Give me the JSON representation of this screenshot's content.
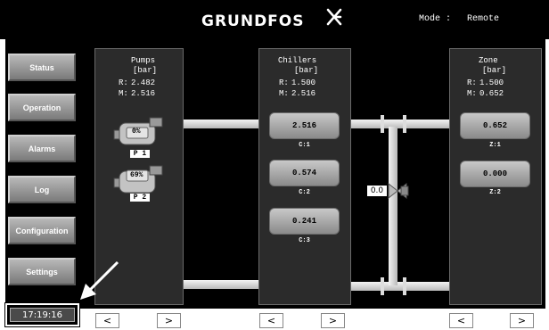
{
  "header": {
    "logo": "GRUNDFOS",
    "mode_label": "Mode :",
    "mode_value": "Remote"
  },
  "sidebar": {
    "items": [
      {
        "label": "Status"
      },
      {
        "label": "Operation"
      },
      {
        "label": "Alarms"
      },
      {
        "label": "Log"
      },
      {
        "label": "Configuration"
      },
      {
        "label": "Settings"
      }
    ]
  },
  "clock": "17:19:16",
  "pumps_panel": {
    "title": "Pumps",
    "unit": "[bar]",
    "r_label": "R:",
    "r_value": "2.482",
    "m_label": "M:",
    "m_value": "2.516",
    "pumps": [
      {
        "speed": "0%",
        "label": "P 1"
      },
      {
        "speed": "69%",
        "label": "P 2"
      }
    ]
  },
  "chillers_panel": {
    "title": "Chillers",
    "unit": "[bar]",
    "r_label": "R:",
    "r_value": "1.500",
    "m_label": "M:",
    "m_value": "2.516",
    "chillers": [
      {
        "value": "2.516",
        "label": "C:1"
      },
      {
        "value": "0.574",
        "label": "C:2"
      },
      {
        "value": "0.241",
        "label": "C:3"
      }
    ]
  },
  "zone_panel": {
    "title": "Zone",
    "unit": "[bar]",
    "r_label": "R:",
    "r_value": "1.500",
    "m_label": "M:",
    "m_value": "0.652",
    "zones": [
      {
        "value": "0.652",
        "label": "Z:1"
      },
      {
        "value": "0.000",
        "label": "Z:2"
      }
    ]
  },
  "valve": {
    "value": "0.0"
  },
  "nav": {
    "prev": "<",
    "next": ">"
  },
  "colors": {
    "background": "#000000",
    "panel": "#2b2b2b",
    "pipe": "#d8d8d8"
  }
}
